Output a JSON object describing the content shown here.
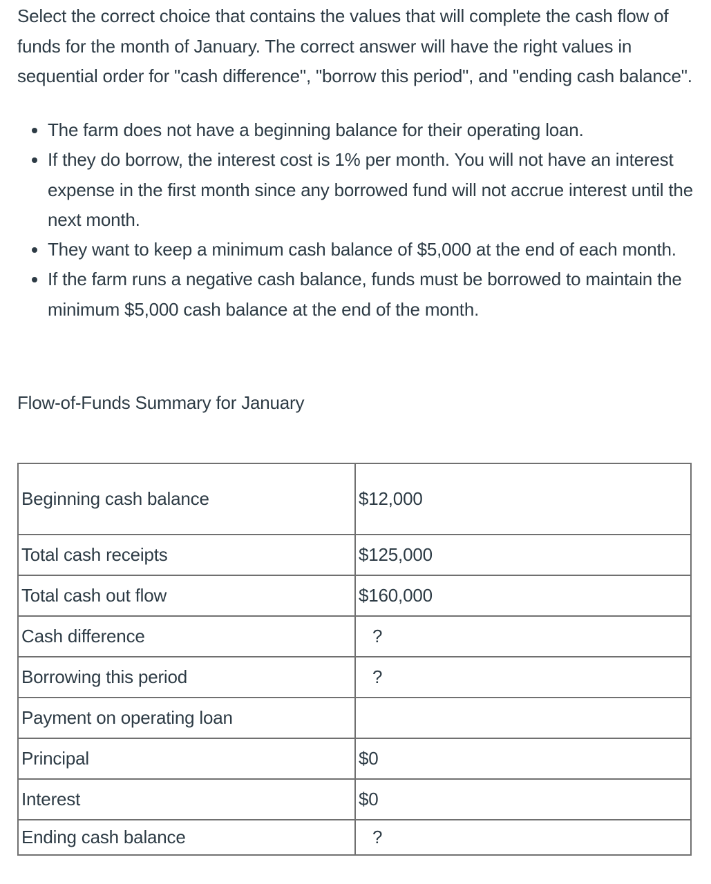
{
  "question": {
    "prompt": "Select the correct choice that contains the values that will complete the cash flow of funds for the month of January. The correct answer will have the right values in sequential order  for \"cash difference\", \"borrow this period\", and \"ending cash balance\".",
    "bullets": [
      "The farm does not have a beginning balance for their operating loan.",
      "If they do borrow, the interest cost is 1% per month. You will not have an interest expense in the first month since any borrowed fund will not accrue interest until the next month.",
      "They want to keep a minimum cash balance of $5,000 at the end of each month.",
      "If the farm runs a negative cash balance, funds must be borrowed to maintain the minimum $5,000 cash balance at the end of the month."
    ]
  },
  "table": {
    "title": "Flow-of-Funds Summary for January",
    "rows": [
      {
        "label": "Beginning cash balance",
        "value": "$12,000"
      },
      {
        "label": "Total cash receipts",
        "value": "$125,000"
      },
      {
        "label": "Total cash out flow",
        "value": "$160,000"
      },
      {
        "label": "Cash difference",
        "value": "?"
      },
      {
        "label": "Borrowing this period",
        "value": "?"
      },
      {
        "label": "Payment on operating loan",
        "value": ""
      },
      {
        "label": "Principal",
        "value": "$0"
      },
      {
        "label": "Interest",
        "value": "$0"
      },
      {
        "label": "Ending cash balance",
        "value": "?"
      }
    ]
  }
}
